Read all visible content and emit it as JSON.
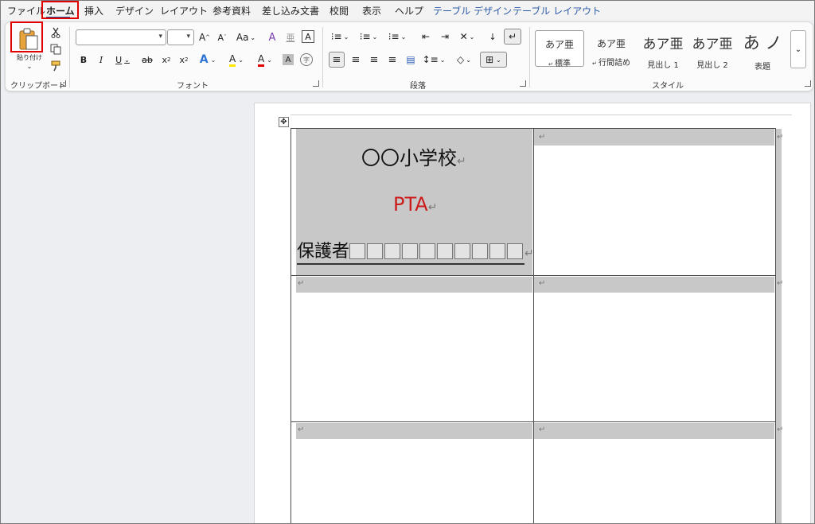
{
  "menu": {
    "tabs": [
      "ファイル",
      "ホーム",
      "挿入",
      "デザイン",
      "レイアウト",
      "参考資料",
      "差し込み文書",
      "校閲",
      "表示",
      "ヘルプ",
      "テーブル デザイン",
      "テーブル レイアウト"
    ],
    "active_tab": "ホーム"
  },
  "clipboard": {
    "paste_label": "貼り付け",
    "group_label": "クリップボード"
  },
  "font": {
    "group_label": "フォント",
    "font_name": "",
    "font_size": "",
    "grow": "A",
    "shrink": "A",
    "case": "Aa",
    "clear_format": "A",
    "char_border": "A",
    "bold": "B",
    "italic": "I",
    "underline": "U",
    "strike": "ab",
    "subscript": "x",
    "superscript": "x",
    "text_effect": "A",
    "highlight": "A",
    "font_color": "A",
    "char_shade": "A",
    "enclose": "字"
  },
  "paragraph": {
    "group_label": "段落"
  },
  "styles": {
    "group_label": "スタイル",
    "items": [
      {
        "sample": "あア亜",
        "name": "標準"
      },
      {
        "sample": "あア亜",
        "name": "行間詰め"
      },
      {
        "sample": "あア亜",
        "name": "見出し 1"
      },
      {
        "sample": "あア亜",
        "name": "見出し 2"
      },
      {
        "sample": "あ ノ",
        "name": "表題"
      }
    ]
  },
  "document": {
    "school": "〇〇小学校",
    "org": "PTA",
    "guardian": "保護者",
    "guardian_box_count": 10,
    "return_mark": "↵",
    "colors": {
      "org": "#cc1a1a",
      "shade": "#c8c8c8"
    }
  }
}
